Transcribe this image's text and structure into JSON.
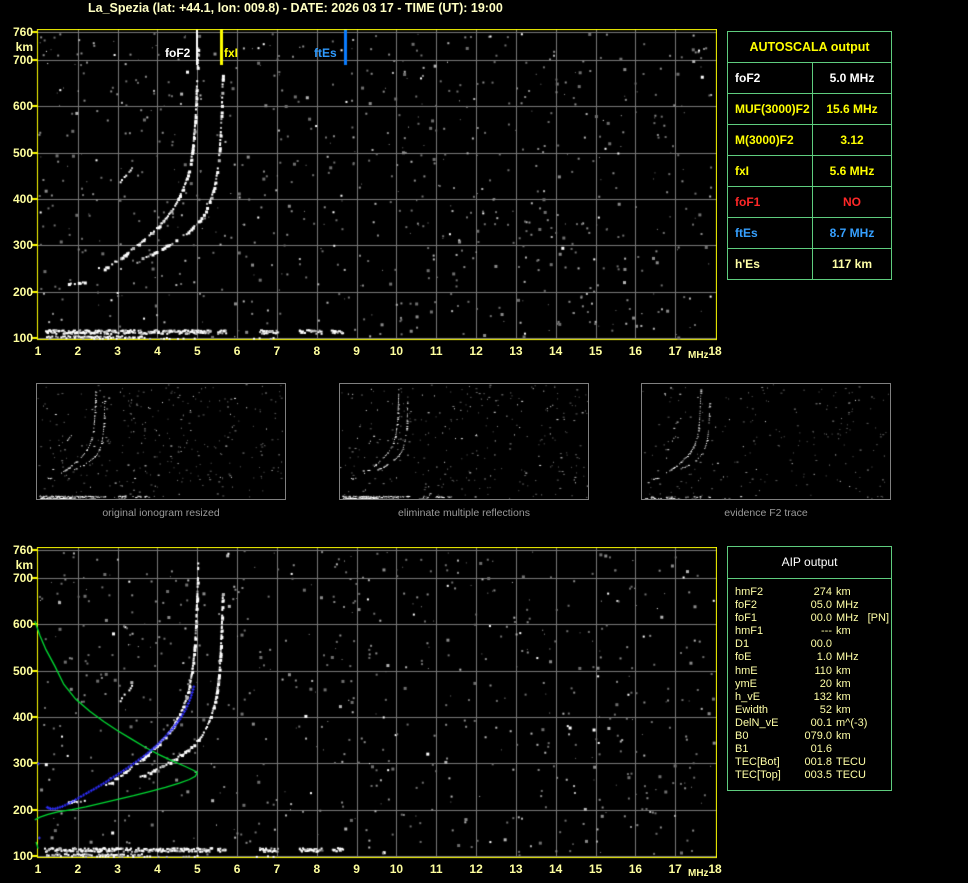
{
  "title": "La_Spezia (lat: +44.1, lon: 009.8) - DATE: 2026 03 17 - TIME (UT): 19:00",
  "colors": {
    "background": "#000000",
    "plot_border": "#ffff00",
    "axis_label": "#ffff9e",
    "grid": "#787878",
    "trace_white": "#ffffff",
    "trace_gray": "#b9b9b9",
    "profile_green": "#00dd33",
    "restored_blue": "#2e2eff",
    "marker_foF2": "#ffffff",
    "marker_fxI": "#ffff00",
    "marker_ftEs_line": "#0a7cff",
    "marker_ftEs_text": "#2f9bff",
    "table_border_green": "#5ecc7e",
    "table_yellow": "#ffff00",
    "table_white": "#ffffff",
    "table_red": "#ff2828",
    "table_blue": "#36a0ff",
    "table_pale_yellow": "#ffffa6",
    "caption_gray": "#9a9a9a"
  },
  "top_plot": {
    "y_ticks": [
      "760",
      "700",
      "600",
      "500",
      "400",
      "300",
      "200",
      "100"
    ],
    "y_unit": "km",
    "x_ticks": [
      "1",
      "2",
      "3",
      "4",
      "5",
      "6",
      "7",
      "8",
      "9",
      "10",
      "11",
      "12",
      "13",
      "14",
      "15",
      "16",
      "17",
      "18"
    ],
    "x_unit": "MHz",
    "markers": [
      {
        "label": "foF2",
        "f": 5.0,
        "line_color": "#ffffff",
        "text_color": "#ffffff"
      },
      {
        "label": "fxI",
        "f": 5.6,
        "line_color": "#ffff00",
        "text_color": "#ffff00"
      },
      {
        "label": "ftEs",
        "f": 8.7,
        "line_color": "#0a7cff",
        "text_color": "#2f9bff"
      }
    ],
    "noise": {
      "count": 760,
      "seed": 7
    }
  },
  "bottom_plot": {
    "y_ticks": [
      "760",
      "700",
      "600",
      "500",
      "400",
      "300",
      "200",
      "100"
    ],
    "y_unit": "km",
    "x_ticks": [
      "1",
      "2",
      "3",
      "4",
      "5",
      "6",
      "7",
      "8",
      "9",
      "10",
      "11",
      "12",
      "13",
      "14",
      "15",
      "16",
      "17",
      "18"
    ],
    "x_unit": "MHz",
    "noise": {
      "count": 680,
      "seed": 13
    }
  },
  "thumbnails": [
    {
      "caption": "original ionogram resized",
      "render": {
        "noise_count": 330,
        "seed": 21,
        "es_keep": 0.8
      }
    },
    {
      "caption": "eliminate multiple reflections",
      "render": {
        "noise_count": 300,
        "seed": 33,
        "es_keep": 0.8
      }
    },
    {
      "caption": "evidence F2 trace",
      "render": {
        "noise_count": 215,
        "seed": 44,
        "es_keep": 0.22
      }
    }
  ],
  "autoscala_table": {
    "header": "AUTOSCALA output",
    "rows": [
      {
        "label": "foF2",
        "value": "5.0 MHz",
        "color": "#ffffff"
      },
      {
        "label": "MUF(3000)F2",
        "value": "15.6 MHz",
        "color": "#ffff00"
      },
      {
        "label": "M(3000)F2",
        "value": "3.12",
        "color": "#ffff00"
      },
      {
        "label": "fxI",
        "value": "5.6 MHz",
        "color": "#ffff00"
      },
      {
        "label": "foF1",
        "value": "NO",
        "color": "#ff2828"
      },
      {
        "label": "ftEs",
        "value": "8.7 MHz",
        "color": "#36a0ff"
      },
      {
        "label": "h'Es",
        "value": "117   km",
        "color": "#ffffa6"
      }
    ]
  },
  "aip_table": {
    "header": "AIP output",
    "rows": [
      {
        "label": "hmF2",
        "value": "274",
        "unit": "km",
        "note": ""
      },
      {
        "label": "foF2",
        "value": "05.0",
        "unit": "MHz",
        "note": ""
      },
      {
        "label": "foF1",
        "value": "00.0",
        "unit": "MHz",
        "note": "[PN]"
      },
      {
        "label": "hmF1",
        "value": "---",
        "unit": "km",
        "note": ""
      },
      {
        "label": "D1",
        "value": "00.0",
        "unit": "",
        "note": ""
      },
      {
        "label": "foE",
        "value": "1.0",
        "unit": "MHz",
        "note": ""
      },
      {
        "label": "hmE",
        "value": "110",
        "unit": "km",
        "note": ""
      },
      {
        "label": "ymE",
        "value": "20",
        "unit": "km",
        "note": ""
      },
      {
        "label": "h_vE",
        "value": "132",
        "unit": "km",
        "note": ""
      },
      {
        "label": "Ewidth",
        "value": "52",
        "unit": "km",
        "note": ""
      },
      {
        "label": "DelN_vE",
        "value": "00.1",
        "unit": "m^(-3)",
        "note": ""
      },
      {
        "label": "B0",
        "value": "079.0",
        "unit": "km",
        "note": ""
      },
      {
        "label": "B1",
        "value": "01.6",
        "unit": "",
        "note": ""
      },
      {
        "label": "TEC[Bot]",
        "value": "001.8",
        "unit": "TECU",
        "note": ""
      },
      {
        "label": "TEC[Top]",
        "value": "003.5",
        "unit": "TECU",
        "note": ""
      }
    ]
  },
  "chart_data": [
    {
      "type": "scatter",
      "title": "Ionogram - La_Spezia 2026-03-17 19:00 UT (autoscaled)",
      "xlabel": "MHz",
      "ylabel": "km",
      "xlim": [
        1,
        18
      ],
      "ylim": [
        100,
        760
      ],
      "grid": true,
      "markers": [
        {
          "name": "foF2",
          "f_MHz": 5.0
        },
        {
          "name": "fxI",
          "f_MHz": 5.6
        },
        {
          "name": "ftEs",
          "f_MHz": 8.7
        }
      ],
      "series": [
        {
          "name": "O-mode F2 trace",
          "color": "#ffffff",
          "segments": [
            [
              [
                1.75,
                218
              ],
              [
                1.9,
                220
              ],
              [
                2.05,
                221
              ],
              [
                2.2,
                223
              ]
            ],
            [
              [
                2.65,
                252
              ],
              [
                2.8,
                260
              ],
              [
                2.95,
                268
              ],
              [
                3.1,
                277
              ],
              [
                3.25,
                287
              ],
              [
                3.4,
                297
              ],
              [
                3.55,
                307
              ],
              [
                3.7,
                318
              ],
              [
                3.85,
                330
              ],
              [
                4.0,
                342
              ],
              [
                4.15,
                356
              ],
              [
                4.3,
                372
              ],
              [
                4.42,
                388
              ],
              [
                4.52,
                404
              ],
              [
                4.62,
                422
              ],
              [
                4.7,
                442
              ],
              [
                4.77,
                462
              ],
              [
                4.82,
                484
              ],
              [
                4.86,
                508
              ],
              [
                4.89,
                532
              ],
              [
                4.915,
                558
              ],
              [
                4.935,
                584
              ],
              [
                4.95,
                610
              ],
              [
                4.96,
                636
              ],
              [
                4.975,
                660
              ],
              [
                4.985,
                686
              ],
              [
                4.995,
                712
              ],
              [
                5.0,
                736
              ]
            ]
          ]
        },
        {
          "name": "X-mode F2 trace",
          "color": "#ffffff",
          "segments": [
            [
              [
                3.55,
                272
              ],
              [
                3.75,
                280
              ],
              [
                3.95,
                288
              ],
              [
                4.15,
                297
              ],
              [
                4.35,
                307
              ],
              [
                4.55,
                318
              ],
              [
                4.75,
                330
              ],
              [
                4.9,
                342
              ],
              [
                5.05,
                356
              ],
              [
                5.17,
                372
              ],
              [
                5.27,
                390
              ],
              [
                5.35,
                410
              ],
              [
                5.42,
                432
              ],
              [
                5.47,
                456
              ],
              [
                5.51,
                482
              ],
              [
                5.54,
                510
              ],
              [
                5.56,
                538
              ],
              [
                5.575,
                566
              ],
              [
                5.59,
                594
              ],
              [
                5.6,
                622
              ],
              [
                5.61,
                650
              ],
              [
                5.62,
                672
              ]
            ]
          ]
        },
        {
          "name": "trace fragment",
          "color": "#ffffff",
          "segments": [
            [
              [
                3.05,
                437
              ],
              [
                3.15,
                449
              ],
              [
                3.27,
                461
              ],
              [
                3.37,
                471
              ]
            ]
          ]
        },
        {
          "name": "Es layer band",
          "h_range": [
            111,
            119
          ],
          "f_segments": [
            [
              1.15,
              3.0
            ],
            [
              3.05,
              4.35
            ],
            [
              4.4,
              5.05
            ],
            [
              5.1,
              5.35
            ],
            [
              5.5,
              5.7
            ],
            [
              6.55,
              7.0
            ],
            [
              7.55,
              8.1
            ],
            [
              8.35,
              8.65
            ]
          ]
        },
        {
          "name": "Es thin lower line",
          "h_range": [
            103,
            106
          ],
          "f_segments": [
            [
              1.2,
              3.6
            ]
          ]
        },
        {
          "name": "ground scatter row",
          "h_range": [
            100,
            102.5
          ],
          "sparse": true,
          "f_segments": [
            [
              1.2,
              5.0
            ],
            [
              6.4,
              7.0
            ]
          ]
        }
      ]
    },
    {
      "type": "line+scatter",
      "title": "Ionogram with AIP electron density profile",
      "xlabel": "MHz",
      "ylabel": "km",
      "xlim": [
        1,
        18
      ],
      "ylim": [
        100,
        760
      ],
      "grid": true,
      "ionogram": "same scatter points as top chart",
      "series": [
        {
          "name": "AIP N(h) profile",
          "color": "#00dd33",
          "points": [
            [
              0.92,
              607
            ],
            [
              1.05,
              575
            ],
            [
              1.2,
              545
            ],
            [
              1.42,
              510
            ],
            [
              1.65,
              470
            ],
            [
              1.95,
              438
            ],
            [
              2.3,
              412
            ],
            [
              2.65,
              390
            ],
            [
              3.0,
              370
            ],
            [
              3.35,
              352
            ],
            [
              3.7,
              334
            ],
            [
              4.05,
              318
            ],
            [
              4.4,
              304
            ],
            [
              4.7,
              293
            ],
            [
              4.9,
              285
            ],
            [
              5.0,
              280
            ],
            [
              4.95,
              272
            ],
            [
              4.8,
              265
            ],
            [
              4.55,
              257
            ],
            [
              4.2,
              248
            ],
            [
              3.8,
              239
            ],
            [
              3.4,
              230
            ],
            [
              3.0,
              222
            ],
            [
              2.6,
              214
            ],
            [
              2.2,
              206
            ],
            [
              1.85,
              200
            ],
            [
              1.5,
              195
            ],
            [
              1.25,
              190
            ],
            [
              1.05,
              184
            ],
            [
              0.92,
              178
            ]
          ]
        },
        {
          "name": "E-region profile segment",
          "color": "#00dd33",
          "points": [
            [
              0.95,
              130
            ],
            [
              0.98,
              123
            ],
            [
              1.0,
              116
            ]
          ]
        },
        {
          "name": "restored trace (fit)",
          "color": "#2e2eff",
          "points": [
            [
              1.22,
              206
            ],
            [
              1.3,
              203
            ],
            [
              1.42,
              203
            ],
            [
              1.6,
              208
            ],
            [
              1.8,
              216
            ],
            [
              2.0,
              226
            ],
            [
              2.2,
              236
            ],
            [
              2.45,
              248
            ],
            [
              2.7,
              261
            ],
            [
              2.95,
              275
            ],
            [
              3.2,
              289
            ],
            [
              3.45,
              304
            ],
            [
              3.7,
              320
            ],
            [
              3.95,
              338
            ],
            [
              4.15,
              355
            ],
            [
              4.35,
              374
            ],
            [
              4.55,
              396
            ],
            [
              4.7,
              418
            ],
            [
              4.82,
              442
            ],
            [
              4.9,
              466
            ],
            [
              4.95,
              470
            ]
          ]
        },
        {
          "name": "stray fit points",
          "color": "#2e2eff",
          "points": [
            [
              1.0,
              300
            ],
            [
              1.02,
              140
            ]
          ]
        }
      ]
    }
  ]
}
